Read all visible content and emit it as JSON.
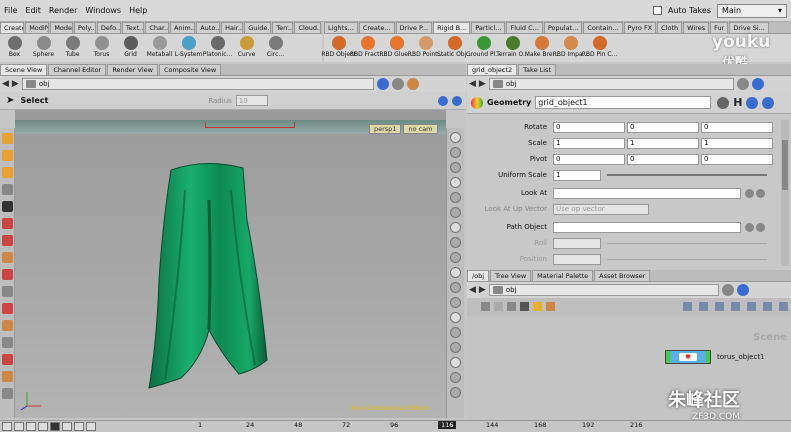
{
  "menu": [
    "File",
    "Edit",
    "Render",
    "Windows",
    "Help"
  ],
  "auto_takes_label": "Auto Takes",
  "desktop": "Main",
  "shelf_tabs_left": [
    "Create",
    "Modify",
    "Model",
    "Poly...",
    "Defo...",
    "Text...",
    "Char...",
    "Anim...",
    "Auto...",
    "Hair...",
    "Guide...",
    "Terr...",
    "Cloud..."
  ],
  "shelf_tabs_right": [
    "Lights...",
    "Create...",
    "Drive P...",
    "Rigid B...",
    "Particl...",
    "Fluid C...",
    "Populat...",
    "Contain...",
    "Pyro FX",
    "Cloth",
    "Wires",
    "Fur",
    "Drive Si..."
  ],
  "tools_left": [
    {
      "label": "Box",
      "color": "#6e6e6e"
    },
    {
      "label": "Sphere",
      "color": "#8a8a8a"
    },
    {
      "label": "Tube",
      "color": "#7a7a7a"
    },
    {
      "label": "Torus",
      "color": "#909090"
    },
    {
      "label": "Grid",
      "color": "#5d5d5d"
    },
    {
      "label": "Metaball",
      "color": "#9a9a9a"
    },
    {
      "label": "L-System",
      "color": "#4aa0c8"
    },
    {
      "label": "Platonic...",
      "color": "#6a6a6a"
    },
    {
      "label": "Curve",
      "color": "#c89a3a"
    },
    {
      "label": "Circ...",
      "color": "#7a7a7a"
    }
  ],
  "tools_right": [
    {
      "label": "RBD Object",
      "color": "#d46a2a"
    },
    {
      "label": "RBD Fract...",
      "color": "#e8732a"
    },
    {
      "label": "RBD Glue...",
      "color": "#e8732a"
    },
    {
      "label": "RBD Point...",
      "color": "#d49a6a"
    },
    {
      "label": "Static Obj...",
      "color": "#d46a2a"
    },
    {
      "label": "Ground Pl...",
      "color": "#3a9a3a"
    },
    {
      "label": "Terrain O...",
      "color": "#4a7a2a"
    },
    {
      "label": "Make Bre...",
      "color": "#d47a3a"
    },
    {
      "label": "RBD Impa...",
      "color": "#d48a4a"
    },
    {
      "label": "RBD Pin C...",
      "color": "#d46a2a"
    }
  ],
  "left_tabs": [
    "Scene View",
    "Channel Editor",
    "Render View",
    "Composite View"
  ],
  "path": "obj",
  "select_label": "Select",
  "radius_label": "Radius",
  "radius_value": "10",
  "cam_persp": "persp1",
  "cam_nocam": "no cam",
  "watermark": "Non-Commercial Edition",
  "right_tabs": [
    "grid_object2",
    "Take List"
  ],
  "geometry_label": "Geometry",
  "geometry_name": "grid_object1",
  "params": {
    "rotate": {
      "label": "Rotate",
      "vals": [
        "0",
        "0",
        "0"
      ]
    },
    "scale": {
      "label": "Scale",
      "vals": [
        "1",
        "1",
        "1"
      ]
    },
    "pivot": {
      "label": "Pivot",
      "vals": [
        "0",
        "0",
        "0"
      ]
    },
    "uniform": {
      "label": "Uniform Scale",
      "val": "1"
    },
    "lookat": {
      "label": "Look At"
    },
    "lookup": {
      "label": "Look At Up Vector",
      "val": "Use up vector"
    },
    "pathobj": {
      "label": "Path Object"
    },
    "roll": {
      "label": "Roll"
    },
    "position": {
      "label": "Position"
    }
  },
  "net_tabs": [
    "/obj",
    "Tree View",
    "Material Palette",
    "Asset Browser"
  ],
  "scene_label": "Scene",
  "node_name": "torus_object1",
  "timeline": {
    "frame": "116",
    "ticks": [
      "1",
      "24",
      "48",
      "72",
      "96",
      "116",
      "144",
      "168",
      "192",
      "216"
    ]
  },
  "logo_top": "youku",
  "logo_top_sub": "优酷",
  "logo_bottom": "朱峰社区",
  "logo_bottom_sub": "ZF3D.COM"
}
